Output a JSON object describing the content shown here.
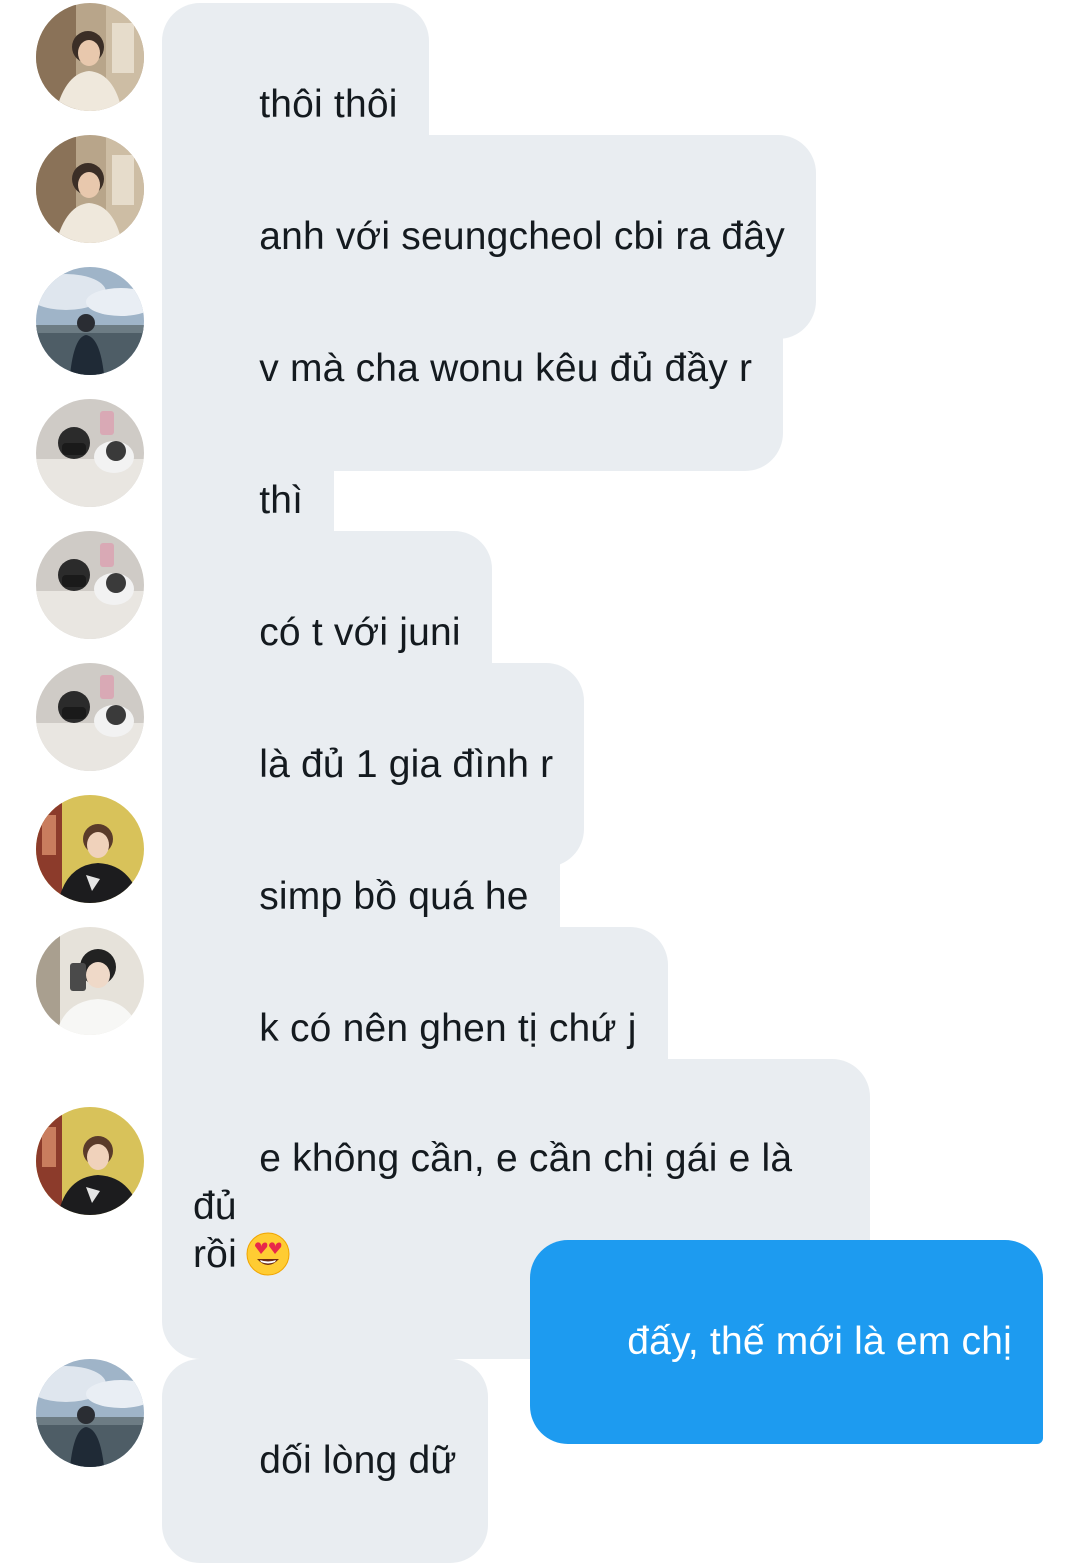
{
  "messages": [
    {
      "side": "incoming",
      "avatar": "avatar-hallway",
      "text": "thôi thôi"
    },
    {
      "side": "incoming",
      "avatar": "avatar-hallway",
      "text": "anh với seungcheol cbi ra đây"
    },
    {
      "side": "incoming",
      "avatar": "avatar-sky",
      "text": "v mà cha wonu kêu đủ đầy r"
    },
    {
      "side": "incoming",
      "avatar": "avatar-dog",
      "text": "thì"
    },
    {
      "side": "incoming",
      "avatar": "avatar-dog",
      "text": "có t với juni"
    },
    {
      "side": "incoming",
      "avatar": "avatar-dog",
      "text": "là đủ 1 gia đình r"
    },
    {
      "side": "incoming",
      "avatar": "avatar-yellow",
      "text": "simp bồ quá he"
    },
    {
      "side": "incoming",
      "avatar": "avatar-mirror",
      "text": "k có nên ghen tị chứ j"
    },
    {
      "side": "incoming",
      "avatar": "avatar-yellow",
      "text": "e không cần, e cần chị gái e là đủ\nrồi",
      "emoji": "heart-eyes-emoji-icon"
    },
    {
      "side": "outgoing",
      "text": "đấy, thế mới là em chị"
    },
    {
      "side": "incoming",
      "avatar": "avatar-sky",
      "text": "dối lòng dữ"
    }
  ],
  "colors": {
    "incoming_bubble": "#e9edf1",
    "incoming_text": "#141a1f",
    "outgoing_bubble": "#1d9bf0",
    "outgoing_text": "#ffffff",
    "background": "#ffffff"
  }
}
